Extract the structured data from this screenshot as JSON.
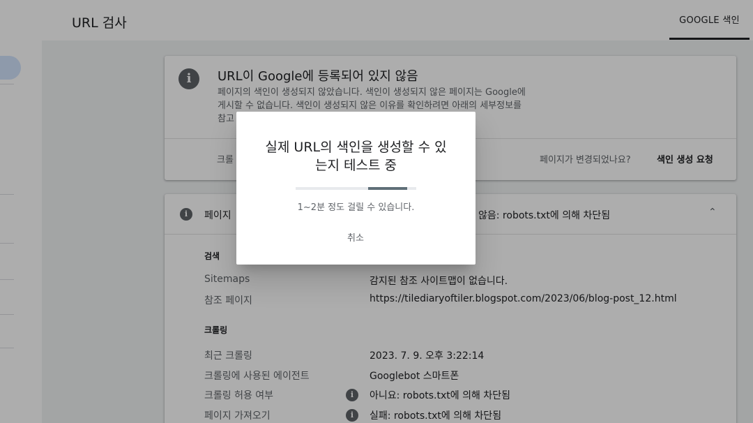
{
  "header": {
    "title": "URL 검사",
    "tab_label": "GOOGLE 색인"
  },
  "status_card": {
    "icon": "info-icon",
    "title": "URL이 Google에 등록되어 있지 않음",
    "description_line1": "페이지의 색인이 생성되지 않았습니다. 색인이 생성되지 않은 페이지는 Google에",
    "description_line2": "게시할 수 없습니다. 색인이 생성되지 않은 이유를 확인하려면 아래의 세부정보를",
    "description_line3": "참고",
    "crawl_label": "크롤",
    "page_changed": "페이지가 변경되었나요?",
    "request_indexing": "색인 생성 요청"
  },
  "detail_card": {
    "title_left": "페이지",
    "title_right": "않음: robots.txt에 의해 차단됨",
    "search_heading": "검색",
    "crawl_heading": "크롤링",
    "rows": [
      {
        "label": "Sitemaps",
        "value": "감지된 참조 사이트맵이 없습니다."
      },
      {
        "label": "참조 페이지",
        "value": "https://tilediaryoftiler.blogspot.com/2023/06/blog-post_12.html"
      },
      {
        "label": "최근 크롤링",
        "value": "2023. 7. 9. 오후 3:22:14"
      },
      {
        "label": "크롤링에 사용된 에이전트",
        "value": "Googlebot 스마트폰"
      },
      {
        "label": "크롤링 허용 여부",
        "value": "아니요: robots.txt에 의해 차단됨"
      },
      {
        "label": "페이지 가져오기",
        "value": "실패: robots.txt에 의해 차단됨"
      }
    ]
  },
  "dialog": {
    "title_line1": "실제 URL의 색인을 생성할 수 있",
    "title_line2": "는지 테스트 중",
    "note": "1~2분 정도 걸릴 수 있습니다.",
    "cancel_label": "취소",
    "progress_indeterminate": true
  },
  "colors": {
    "accent": "#5f6f78",
    "sidebar_active": "#d2e3fc",
    "icon": "#5f6368"
  }
}
